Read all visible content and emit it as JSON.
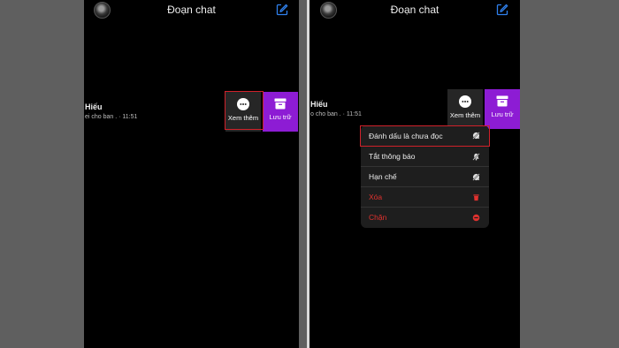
{
  "left": {
    "header": {
      "title": "Đoạn chat"
    },
    "row": {
      "name": "Hiếu",
      "preview": "ei cho ban . · 11:51"
    },
    "actions": {
      "more_label": "Xem thêm",
      "archive_label": "Lưu trữ"
    }
  },
  "right": {
    "header": {
      "title": "Đoạn chat"
    },
    "row": {
      "name": "Hiếu",
      "preview": "o cho ban . · 11:51"
    },
    "actions": {
      "more_label": "Xem thêm",
      "archive_label": "Lưu trữ"
    },
    "menu": {
      "items": [
        {
          "label": "Đánh dấu là chưa đọc",
          "icon": "unread-bubble-icon"
        },
        {
          "label": "Tắt thông báo",
          "icon": "mute-bell-icon"
        },
        {
          "label": "Hạn chế",
          "icon": "restrict-icon"
        },
        {
          "label": "Xóa",
          "icon": "trash-icon"
        },
        {
          "label": "Chặn",
          "icon": "block-icon"
        }
      ]
    }
  },
  "colors": {
    "archive": "#8d1cd4",
    "danger": "#e2322f",
    "highlight": "#d0212a",
    "accent": "#2f80ed"
  }
}
